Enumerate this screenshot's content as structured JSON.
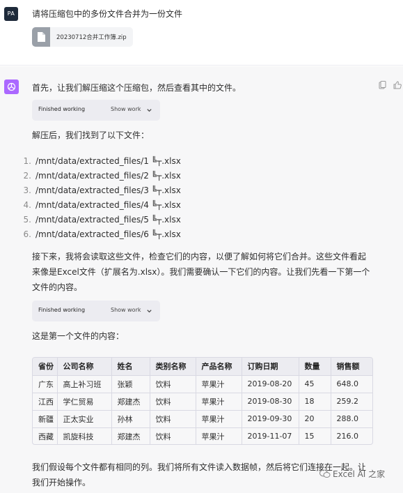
{
  "user": {
    "avatar_initials": "PA",
    "message": "请将压缩包中的多份文件合并为一份文件",
    "attachment": {
      "name": "20230712合并工作簿.zip",
      "icon": "file-icon"
    }
  },
  "assistant": {
    "avatar_icon": "openai-logo-icon",
    "actions": [
      "copy-icon",
      "thumbs-up-icon"
    ],
    "intro": "首先，让我们解压缩这个压缩包，然后查看其中的文件。",
    "work_chip_1": {
      "status": "Finished working",
      "toggle": "Show work"
    },
    "found_text": "解压后，我们找到了以下文件：",
    "files": [
      {
        "num": "1.",
        "path": "/mnt/data/extracted_files/1 ╚┬.xlsx"
      },
      {
        "num": "2.",
        "path": "/mnt/data/extracted_files/2 ╚┬.xlsx"
      },
      {
        "num": "3.",
        "path": "/mnt/data/extracted_files/3 ╚┬.xlsx"
      },
      {
        "num": "4.",
        "path": "/mnt/data/extracted_files/4 ╚┬.xlsx"
      },
      {
        "num": "5.",
        "path": "/mnt/data/extracted_files/5 ╚┬.xlsx"
      },
      {
        "num": "6.",
        "path": "/mnt/data/extracted_files/6 ╚┬.xlsx"
      }
    ],
    "next_lines": [
      "接下来，我将会读取这些文件，检查它们的内容，以便了解如何将它们合并。这些文件看起",
      "来像是Excel文件（扩展名为.xlsx）。我们需要确认一下它们的内容。让我们先看一下第一个",
      "文件的内容。"
    ],
    "work_chip_2": {
      "status": "Finished working",
      "toggle": "Show work"
    },
    "first_file_text": "这是第一个文件的内容：",
    "table": {
      "headers": [
        "省份",
        "公司名称",
        "姓名",
        "类别名称",
        "产品名称",
        "订购日期",
        "数量",
        "销售额"
      ],
      "rows": [
        [
          "广东",
          "高上补习班",
          "张颖",
          "饮料",
          "苹果汁",
          "2019-08-20",
          "45",
          "648.0"
        ],
        [
          "江西",
          "学仁贸易",
          "郑建杰",
          "饮料",
          "苹果汁",
          "2019-08-30",
          "18",
          "259.2"
        ],
        [
          "新疆",
          "正太实业",
          "孙林",
          "饮料",
          "苹果汁",
          "2019-09-30",
          "20",
          "288.0"
        ],
        [
          "西藏",
          "凯旋科技",
          "郑建杰",
          "饮料",
          "苹果汁",
          "2019-11-07",
          "15",
          "216.0"
        ]
      ]
    },
    "closing_lines": [
      "我们假设每个文件都有相同的列。我们将所有文件读入数据帧，然后将它们连接在一起。让",
      "我们开始操作。"
    ]
  },
  "watermark": {
    "icon": "wechat-icon",
    "text": "Excel AI 之家"
  }
}
